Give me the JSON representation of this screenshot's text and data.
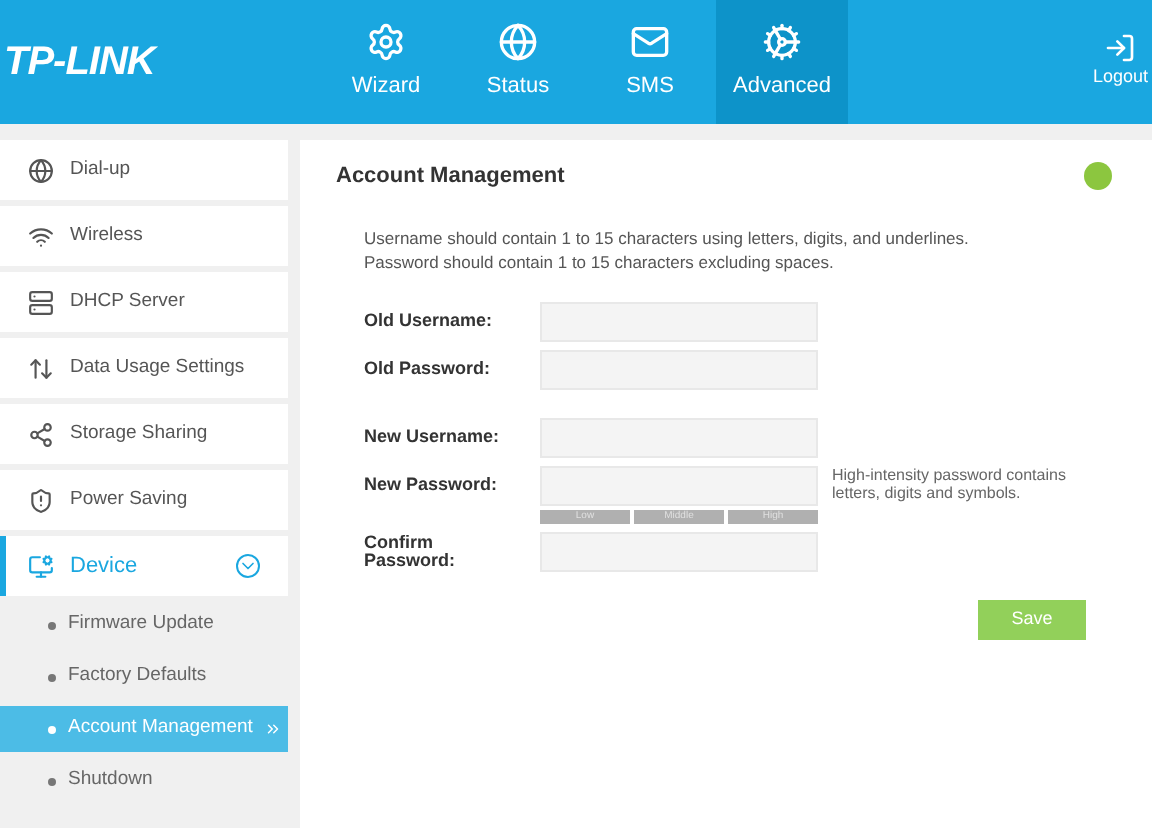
{
  "header": {
    "logo": "TP-LINK",
    "tabs": [
      {
        "label": "Wizard",
        "selected": false
      },
      {
        "label": "Status",
        "selected": false
      },
      {
        "label": "SMS",
        "selected": false
      },
      {
        "label": "Advanced",
        "selected": true
      }
    ],
    "logout": "Logout"
  },
  "sidebar": {
    "items": [
      {
        "label": "Dial-up",
        "selected": false
      },
      {
        "label": "Wireless",
        "selected": false
      },
      {
        "label": "DHCP Server",
        "selected": false
      },
      {
        "label": "Data Usage Settings",
        "selected": false
      },
      {
        "label": "Storage Sharing",
        "selected": false
      },
      {
        "label": "Power Saving",
        "selected": false
      },
      {
        "label": "Device",
        "selected": true,
        "expanded": true,
        "children": [
          {
            "label": "Firmware Update",
            "selected": false
          },
          {
            "label": "Factory Defaults",
            "selected": false
          },
          {
            "label": "Account Management",
            "selected": true
          },
          {
            "label": "Shutdown",
            "selected": false
          }
        ]
      }
    ]
  },
  "panel": {
    "title": "Account Management",
    "description": [
      "Username should contain 1 to 15 characters using letters, digits, and underlines.",
      "Password should contain 1 to 15 characters excluding spaces."
    ],
    "groups": [
      [
        {
          "label": "Old Username:"
        },
        {
          "label": "Old Password:"
        }
      ],
      [
        {
          "label": "New Username:"
        },
        {
          "label": "New Password:",
          "hint": "High-intensity password contains letters, digits and symbols.",
          "strength": [
            "Low",
            "Middle",
            "High"
          ]
        },
        {
          "label": "Confirm Password:"
        }
      ]
    ],
    "save": "Save"
  }
}
